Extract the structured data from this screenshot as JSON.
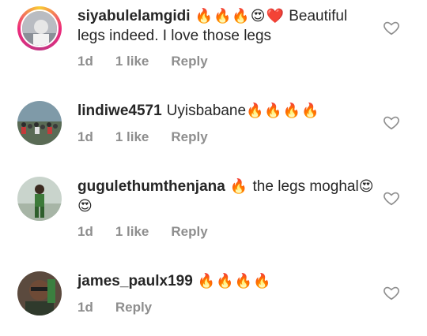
{
  "comments": [
    {
      "username": "siyabulelamgidi",
      "emoji": "🔥🔥🔥😍❤️",
      "text": "Beautiful legs indeed. I love those legs",
      "time": "1d",
      "likes": "1 like",
      "reply": "Reply"
    },
    {
      "username": "lindiwe4571",
      "emoji": "🔥🔥🔥🔥",
      "text": "Uyisbabane",
      "time": "1d",
      "likes": "1 like",
      "reply": "Reply"
    },
    {
      "username": "gugulethumthenjana",
      "emoji": "🔥",
      "text": "the legs moghal",
      "emoji2": "😍😍",
      "time": "1d",
      "likes": "1 like",
      "reply": "Reply"
    },
    {
      "username": "james_paulx199",
      "emoji": "🔥🔥🔥🔥",
      "time": "1d",
      "reply": "Reply"
    }
  ]
}
